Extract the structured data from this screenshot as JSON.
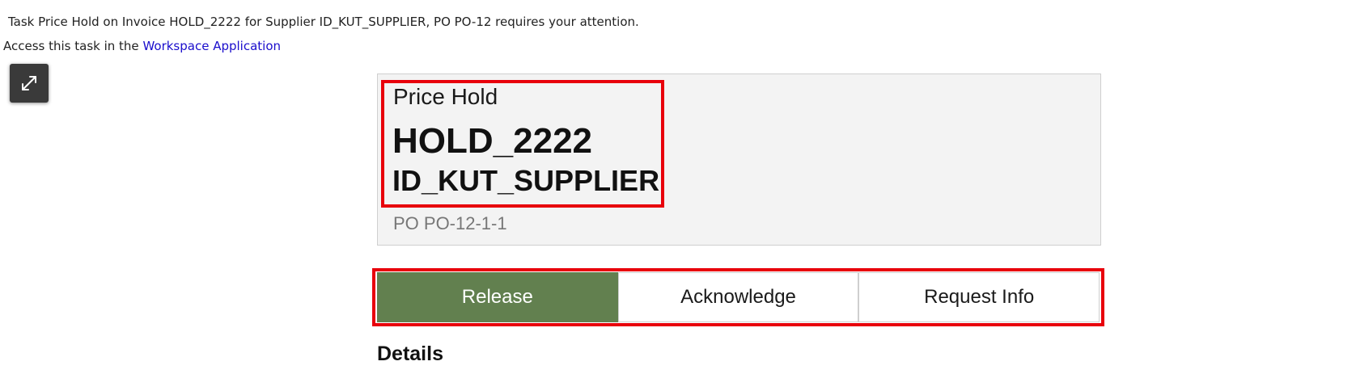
{
  "notice": {
    "text": "Task Price Hold on Invoice HOLD_2222 for Supplier ID_KUT_SUPPLIER, PO PO-12 requires your attention."
  },
  "access": {
    "prefix": "Access this task in the ",
    "link_label": "Workspace Application"
  },
  "expand_button": {
    "icon": "expand-arrows-icon"
  },
  "card": {
    "title": "Price Hold",
    "invoice": "HOLD_2222",
    "supplier": "ID_KUT_SUPPLIER",
    "po": "PO PO-12-1-1"
  },
  "actions": {
    "release_label": "Release",
    "acknowledge_label": "Acknowledge",
    "request_info_label": "Request Info"
  },
  "details": {
    "heading": "Details"
  },
  "colors": {
    "primary_button": "#62804f",
    "highlight": "#e8000b",
    "link": "#1a0dcc"
  }
}
